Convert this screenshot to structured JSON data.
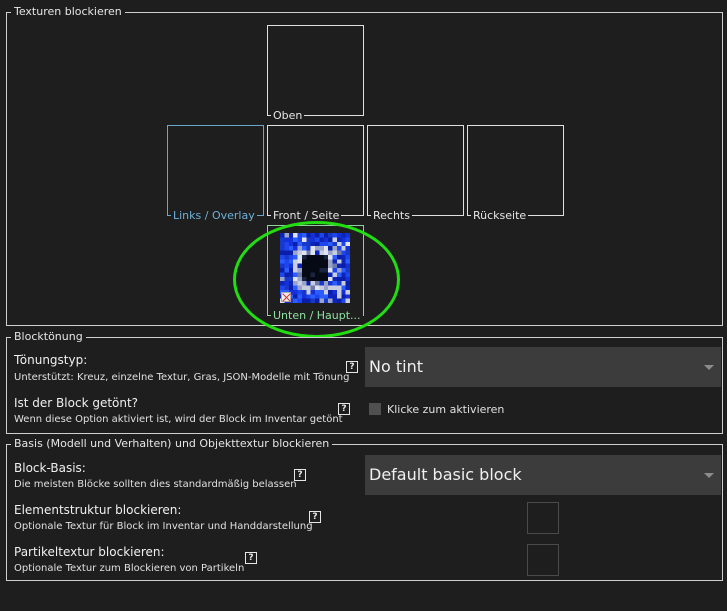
{
  "texture_section": {
    "legend": "Texturen blockieren",
    "slots": {
      "top": "Oben",
      "left": "Links / Overlay",
      "front": "Front / Seite",
      "right": "Rechts",
      "back": "Rückseite",
      "bottom": "Unten / Haupt..."
    }
  },
  "tint_section": {
    "legend": "Blocktönung",
    "tint_type": {
      "title": "Tönungstyp:",
      "desc": "Unterstützt: Kreuz, einzelne Textur, Gras, JSON-Modelle mit Tönung",
      "value": "No tint"
    },
    "tinted_item": {
      "title": "Ist der Block getönt?",
      "desc": "Wenn diese Option aktiviert ist, wird der Block im Inventar getönt",
      "checkbox_label": "Klicke zum aktivieren",
      "checked": false
    }
  },
  "base_section": {
    "legend": "Basis (Modell und Verhalten) und Objekttextur blockieren",
    "block_base": {
      "title": "Block-Basis:",
      "desc": "Die meisten Blöcke sollten dies standardmäßig belassen",
      "value": "Default basic block"
    },
    "item_texture": {
      "title": "Elementstruktur blockieren:",
      "desc": "Optionale Textur für Block im Inventar und Handdarstellung"
    },
    "particle_texture": {
      "title": "Partikeltextur blockieren:",
      "desc": "Optionale Textur zum Blockieren von Partikeln"
    }
  },
  "help_glyph": "?",
  "colors": {
    "background": "#1e1e1e",
    "select_bg": "#3c3c3c",
    "overlay_accent": "#6fb0d8",
    "main_accent": "#8fe0a0",
    "highlight": "#22dd11"
  }
}
